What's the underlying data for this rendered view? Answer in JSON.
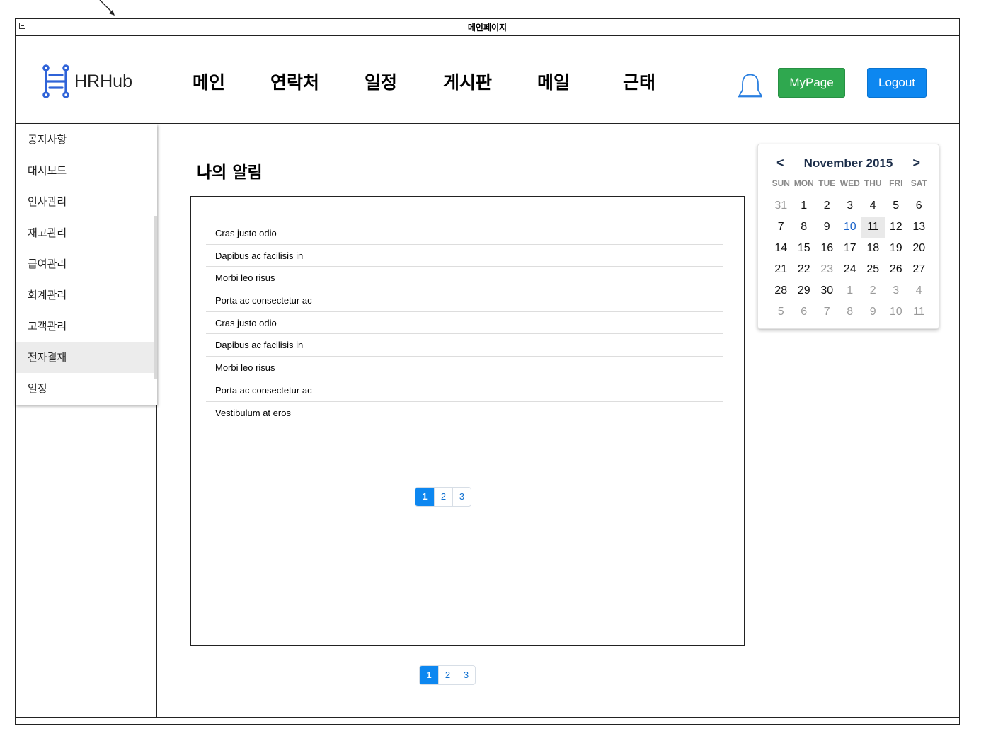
{
  "window": {
    "title": "메인페이지"
  },
  "logo": {
    "text": "HRHub"
  },
  "nav": {
    "items": [
      "메인",
      "연락처",
      "일정",
      "게시판",
      "메일",
      "근태"
    ],
    "mypage_label": "MyPage",
    "logout_label": "Logout"
  },
  "sidebar": {
    "items": [
      "공지사항",
      "대시보드",
      "인사관리",
      "재고관리",
      "급여관리",
      "회계관리",
      "고객관리",
      "전자결재",
      "일정"
    ],
    "active_item": "전자결재"
  },
  "content": {
    "title": "나의 알림",
    "notifications": [
      "Cras justo odio",
      "Dapibus ac facilisis in",
      "Morbi leo risus",
      "Porta ac consectetur ac",
      "Cras justo odio",
      "Dapibus ac facilisis in",
      "Morbi leo risus",
      "Porta ac consectetur ac",
      "Vestibulum at eros"
    ],
    "inner_pager": [
      "1",
      "2",
      "3"
    ],
    "outer_pager": [
      "1",
      "2",
      "3"
    ],
    "current_page": "1"
  },
  "calendar": {
    "prev_label": "<",
    "next_label": ">",
    "month_title": "November 2015",
    "weekdays": [
      "SUN",
      "MON",
      "TUE",
      "WED",
      "THU",
      "FRI",
      "SAT"
    ],
    "days": [
      "31",
      "1",
      "2",
      "3",
      "4",
      "5",
      "6",
      "7",
      "8",
      "9",
      "10",
      "11",
      "12",
      "13",
      "14",
      "15",
      "16",
      "17",
      "18",
      "19",
      "20",
      "21",
      "22",
      "23",
      "24",
      "25",
      "26",
      "27",
      "28",
      "29",
      "30",
      "1",
      "2",
      "3",
      "4",
      "5",
      "6",
      "7",
      "8",
      "9",
      "10",
      "11"
    ],
    "muted_indices": [
      0,
      23,
      31,
      32,
      33,
      34,
      35,
      36,
      37,
      38,
      39,
      40,
      41
    ],
    "today_index": 10,
    "selected_index": 11
  },
  "colors": {
    "mypage_button": "#2fa84f",
    "logout_button": "#0d87f0",
    "logo_accent": "#2f63d8",
    "bell_icon": "#2a7fe0"
  }
}
